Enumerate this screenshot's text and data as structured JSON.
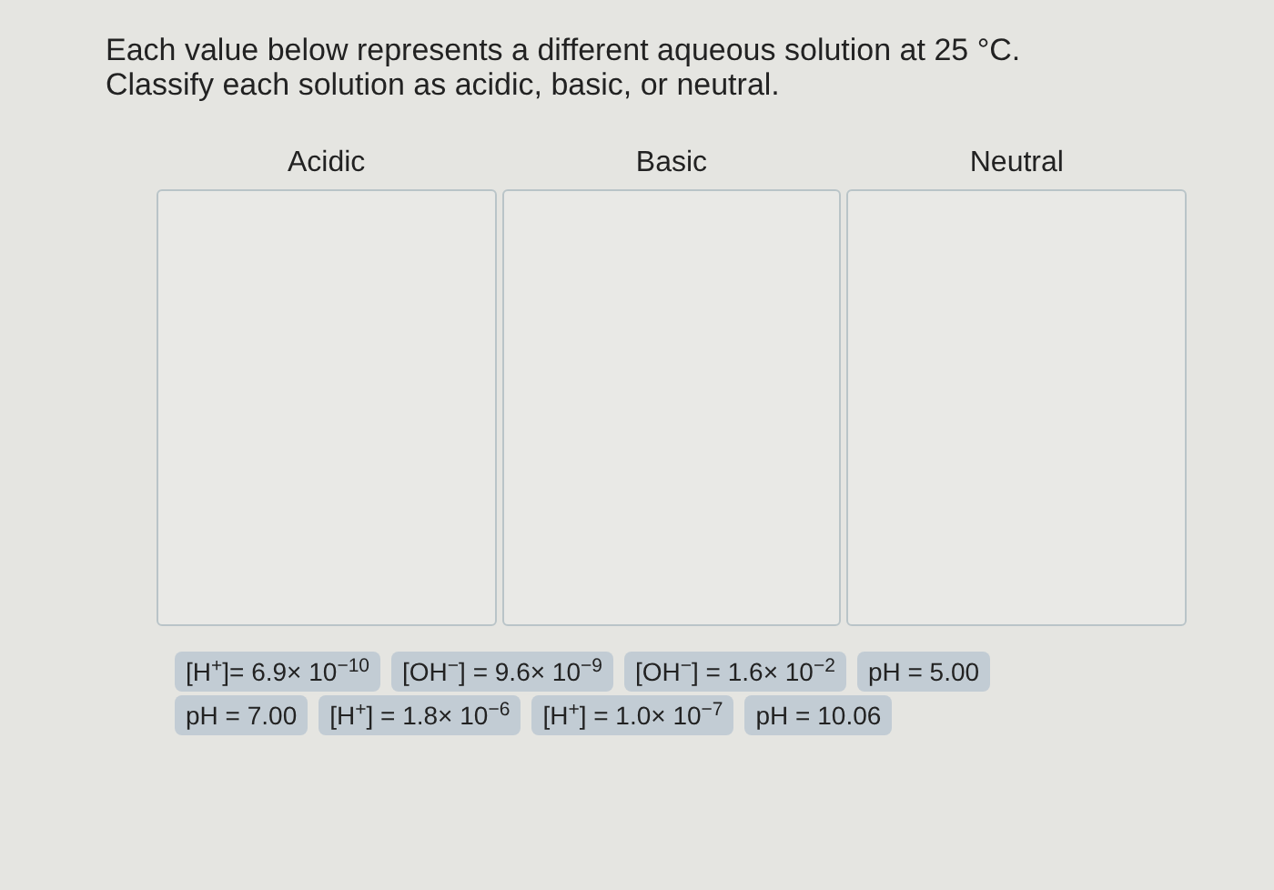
{
  "instructions": [
    "Each value below represents a different aqueous solution at 25 °C.",
    "Classify each solution as acidic, basic, or neutral."
  ],
  "bins": [
    {
      "label": "Acidic"
    },
    {
      "label": "Basic"
    },
    {
      "label": "Neutral"
    }
  ],
  "tile_rows": [
    [
      "[H$^{+}$]= 6.9× 10$^{−10}$",
      "[OH$^{−}$] = 9.6× 10$^{−9}$",
      "[OH$^{−}$] = 1.6× 10$^{−2}$",
      "pH = 5.00"
    ],
    [
      "pH = 7.00",
      "[H$^{+}$] = 1.8× 10$^{−6}$",
      "[H$^{+}$] = 1.0× 10$^{−7}$",
      "pH = 10.06"
    ]
  ]
}
